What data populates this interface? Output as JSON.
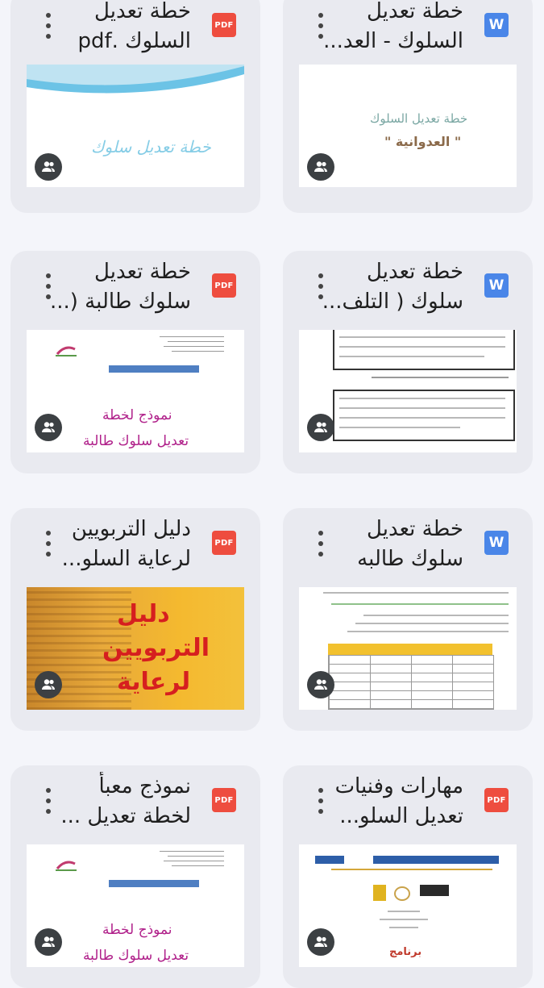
{
  "files": [
    {
      "type_icon": "pdf-icon",
      "type_label": "PDF",
      "title_line1": "خطة تعديل",
      "title_line2": "السلوك .pdf",
      "shared_icon": "people-icon",
      "thumbnail_text": "خطة تعديل سلوك"
    },
    {
      "type_icon": "word-icon",
      "type_label": "W",
      "title_line1": "خطة تعديل",
      "title_line2": "السلوك - العد...",
      "shared_icon": "people-icon",
      "thumbnail_text": "خطة تعديل السلوك",
      "thumbnail_text2": "\" العدوانية \""
    },
    {
      "type_icon": "pdf-icon",
      "type_label": "PDF",
      "title_line1": "خطة تعديل",
      "title_line2": "سلوك طالبة (...",
      "shared_icon": "people-icon",
      "thumbnail_text": "نموذج لخطة",
      "thumbnail_text2": "تعديل سلوك طالبة"
    },
    {
      "type_icon": "word-icon",
      "type_label": "W",
      "title_line1": "خطة تعديل",
      "title_line2": "سلوك ( التلف...",
      "shared_icon": "people-icon"
    },
    {
      "type_icon": "pdf-icon",
      "type_label": "PDF",
      "title_line1": "دليل التربويين",
      "title_line2": "لرعاية السلو...",
      "shared_icon": "people-icon",
      "thumbnail_text": "دليل",
      "thumbnail_text2": "التربويين",
      "thumbnail_text3": "لرعاية"
    },
    {
      "type_icon": "word-icon",
      "type_label": "W",
      "title_line1": "خطة تعديل",
      "title_line2": "سلوك طالبه",
      "shared_icon": "people-icon"
    },
    {
      "type_icon": "pdf-icon",
      "type_label": "PDF",
      "title_line1": "نموذج معبأ",
      "title_line2": "لخطة تعديل ...",
      "shared_icon": "people-icon",
      "thumbnail_text": "نموذج لخطة",
      "thumbnail_text2": "تعديل سلوك طالبة"
    },
    {
      "type_icon": "pdf-icon",
      "type_label": "PDF",
      "title_line1": "مهارات وفنيات",
      "title_line2": "تعديل السلو...",
      "shared_icon": "people-icon",
      "thumbnail_text": "برنامج"
    }
  ],
  "colors": {
    "pdf": "#ee4d3f",
    "word": "#4a86e8",
    "card": "#e9eaf0",
    "background": "#f4f5fa"
  }
}
